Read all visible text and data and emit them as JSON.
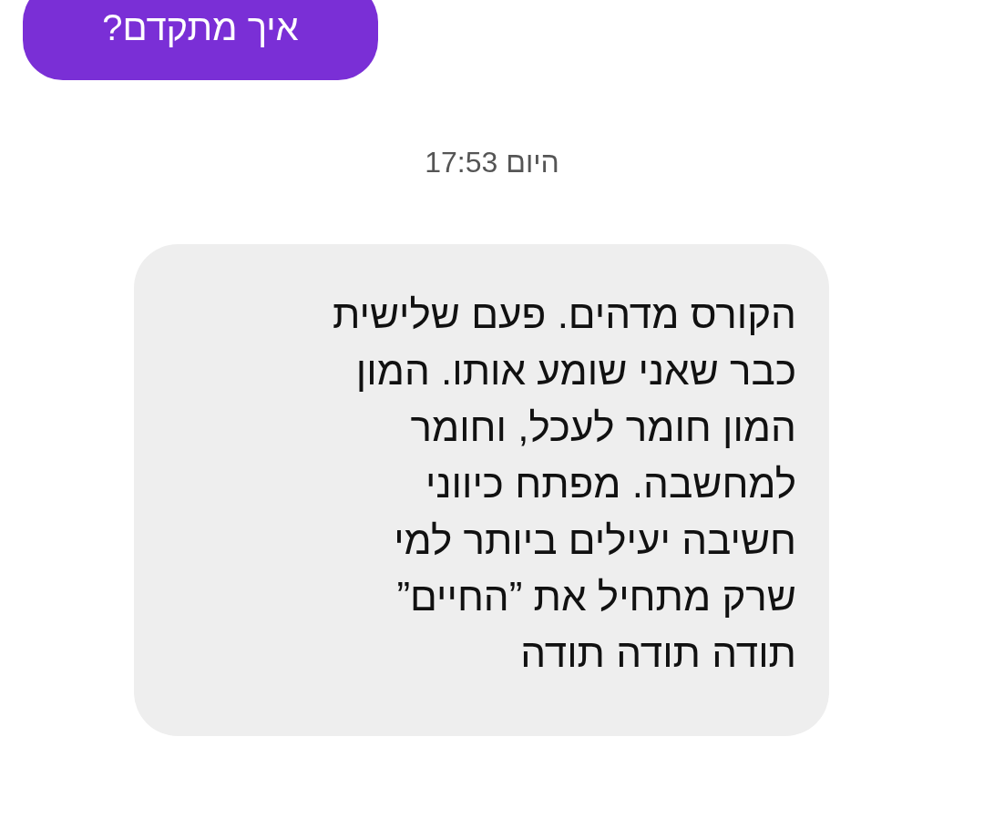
{
  "messages": [
    {
      "kind": "sent",
      "text": "איך מתקדם?"
    },
    {
      "kind": "timestamp",
      "text": "היום 17:53"
    },
    {
      "kind": "received",
      "text": "הקורס מדהים. פעם שלישית\nכבר שאני שומע אותו. המון\nהמון חומר לעכל, וחומר\nלמחשבה. מפתח כיווני\nחשיבה יעילים ביותר למי\nשרק מתחיל את ”החיים”\nתודה תודה תודה"
    }
  ]
}
